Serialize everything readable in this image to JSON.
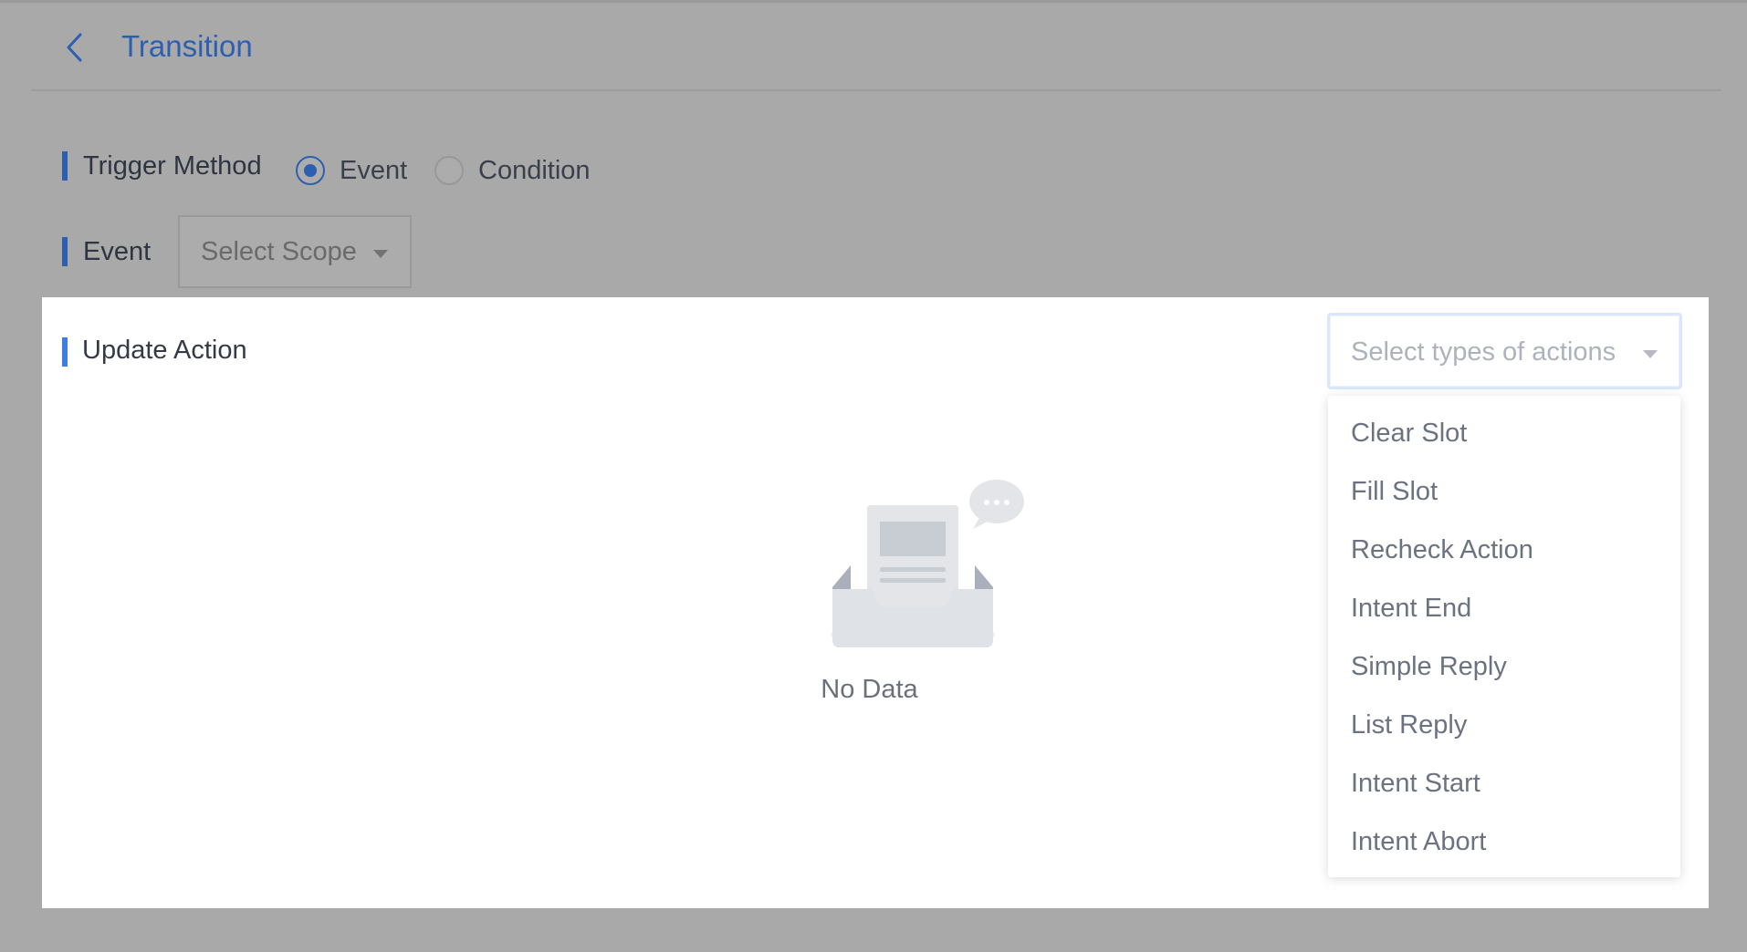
{
  "header": {
    "title": "Transition",
    "back_icon": "chevron-left-icon"
  },
  "trigger": {
    "label": "Trigger Method",
    "options": [
      {
        "label": "Event",
        "checked": true
      },
      {
        "label": "Condition",
        "checked": false
      }
    ]
  },
  "event": {
    "label": "Event",
    "scope_placeholder": "Select Scope"
  },
  "update_action": {
    "label": "Update Action",
    "select_placeholder": "Select types of actions",
    "empty_text": "No Data",
    "empty_icon": "empty-inbox-icon"
  },
  "dropdown": {
    "items": [
      "Clear Slot",
      "Fill Slot",
      "Recheck Action",
      "Intent End",
      "Simple Reply",
      "List Reply",
      "Intent Start",
      "Intent Abort"
    ]
  },
  "colors": {
    "overlay": "#a9a9a9",
    "accent": "#2d5fb0",
    "panel_accent": "#3f7ee5",
    "panel": "#ffffff"
  }
}
